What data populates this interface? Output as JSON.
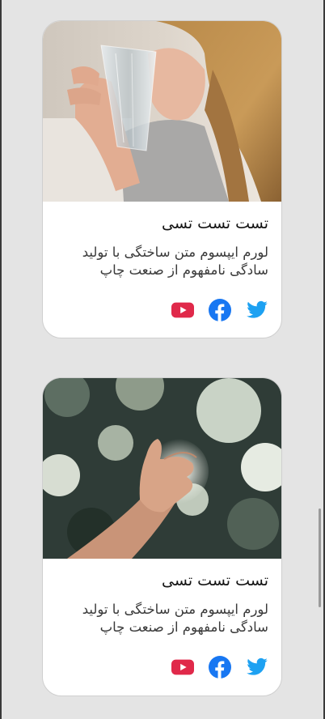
{
  "cards": [
    {
      "image": "woman-drinking-water-photo",
      "title": "تست تست تسی",
      "text": "لورم ایپسوم متن ساختگی با تولید سادگی نامفهوم از صنعت چاپ",
      "social": [
        "twitter-icon",
        "facebook-icon",
        "youtube-icon"
      ]
    },
    {
      "image": "hand-reaching-sunlight-photo",
      "title": "تست تست تسی",
      "text": "لورم ایپسوم متن ساختگی با تولید سادگی نامفهوم از صنعت چاپ",
      "social": [
        "twitter-icon",
        "facebook-icon",
        "youtube-icon"
      ]
    }
  ],
  "colors": {
    "page_background": "#e4e4e4",
    "card_background": "#ffffff",
    "twitter": "#1da1f2",
    "facebook": "#1877f2",
    "youtube": "#e0294a"
  }
}
